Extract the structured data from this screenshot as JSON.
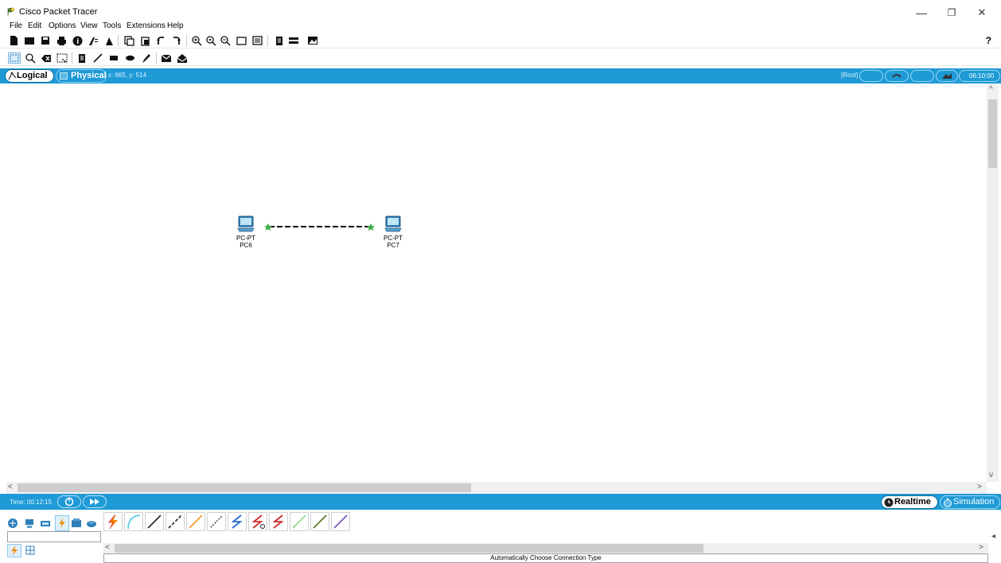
{
  "window": {
    "title": "Cisco Packet Tracer",
    "minimize": "—",
    "restore": "❐",
    "close": "✕"
  },
  "menu": [
    "File",
    "Edit",
    "Options",
    "View",
    "Tools",
    "Extensions",
    "Help"
  ],
  "toolbar": {
    "help_label": "?"
  },
  "mode": {
    "logical_label": "Logical",
    "physical_label": "Physical",
    "coords": "x: 665, y: 514",
    "root_label": "[Root]",
    "clock": "06:10:00"
  },
  "devices": [
    {
      "type_label": "PC-PT",
      "name": "PC6"
    },
    {
      "type_label": "PC-PT",
      "name": "PC7"
    }
  ],
  "sim_bar": {
    "time": "Time: 00:12:15",
    "realtime_label": "Realtime",
    "simulation_label": "Simulation"
  },
  "palette": {
    "status_text": "Automatically Choose Connection Type"
  },
  "colors": {
    "accent_blue": "#1e9ad6",
    "link_status_green": "#3fae49"
  }
}
